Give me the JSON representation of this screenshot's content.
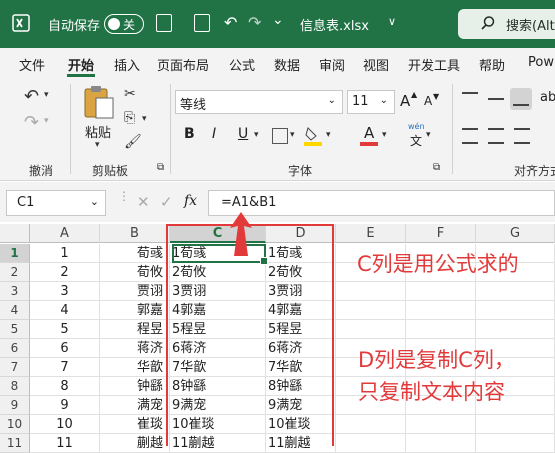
{
  "titlebar": {
    "autosave_label": "自动保存",
    "autosave_state": "关",
    "filename": "信息表.xlsx",
    "filename_suffix": "∨",
    "search_label": "搜索(Alt"
  },
  "menu": {
    "items": [
      "文件",
      "开始",
      "插入",
      "页面布局",
      "公式",
      "数据",
      "审阅",
      "视图",
      "开发工具",
      "帮助",
      "Pow"
    ],
    "active": "开始"
  },
  "ribbon": {
    "undo_group": "撤消",
    "clipboard_group": "剪贴板",
    "paste_label": "粘贴",
    "font_group": "字体",
    "font_name": "等线",
    "font_size": "11",
    "bold": "B",
    "italic": "I",
    "underline": "U",
    "grow_font": "A",
    "shrink_font": "A",
    "font_color_glyph": "A",
    "wen": "wén",
    "wen_char": "文",
    "align_group": "对齐方式"
  },
  "formula_bar": {
    "name_box": "C1",
    "fx": "fx",
    "formula": "=A1&B1"
  },
  "sheet": {
    "columns": [
      "A",
      "B",
      "C",
      "D",
      "E",
      "F",
      "G"
    ],
    "selected_column": "C",
    "rows": [
      {
        "n": "1",
        "a": "1",
        "b": "荀彧",
        "c": "1荀彧",
        "d": "1荀彧"
      },
      {
        "n": "2",
        "a": "2",
        "b": "荀攸",
        "c": "2荀攸",
        "d": "2荀攸"
      },
      {
        "n": "3",
        "a": "3",
        "b": "贾诩",
        "c": "3贾诩",
        "d": "3贾诩"
      },
      {
        "n": "4",
        "a": "4",
        "b": "郭嘉",
        "c": "4郭嘉",
        "d": "4郭嘉"
      },
      {
        "n": "5",
        "a": "5",
        "b": "程昱",
        "c": "5程昱",
        "d": "5程昱"
      },
      {
        "n": "6",
        "a": "6",
        "b": "蒋济",
        "c": "6蒋济",
        "d": "6蒋济"
      },
      {
        "n": "7",
        "a": "7",
        "b": "华歆",
        "c": "7华歆",
        "d": "7华歆"
      },
      {
        "n": "8",
        "a": "8",
        "b": "钟繇",
        "c": "8钟繇",
        "d": "8钟繇"
      },
      {
        "n": "9",
        "a": "9",
        "b": "满宠",
        "c": "9满宠",
        "d": "9满宠"
      },
      {
        "n": "10",
        "a": "10",
        "b": "崔琰",
        "c": "10崔琰",
        "d": "10崔琰"
      },
      {
        "n": "11",
        "a": "11",
        "b": "蒯越",
        "c": "11蒯越",
        "d": "11蒯越"
      }
    ]
  },
  "annotations": {
    "note_c": "C列是用公式求的",
    "note_d_line1": "D列是复制C列，",
    "note_d_line2": "只复制文本内容",
    "color": "#e23a3a"
  },
  "colors": {
    "excel_green": "#217346"
  }
}
